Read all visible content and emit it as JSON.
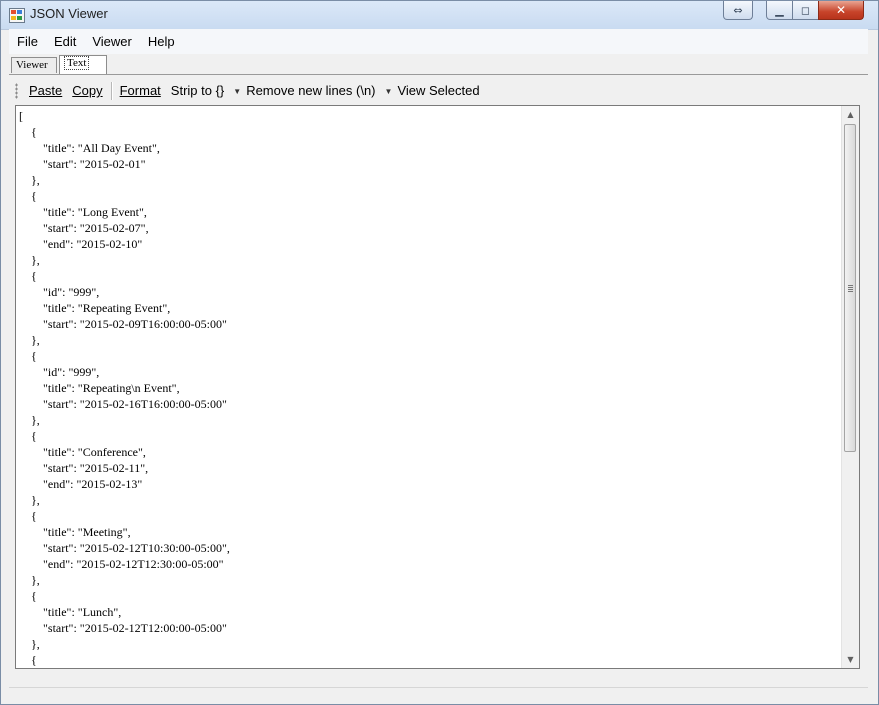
{
  "window": {
    "title": "JSON Viewer"
  },
  "menu": [
    "File",
    "Edit",
    "Viewer",
    "Help"
  ],
  "tabs": {
    "viewer": "Viewer",
    "text": "Text"
  },
  "toolbar": {
    "paste_label": "Paste",
    "copy_label": "Copy",
    "format_label": "Format",
    "strip_label": "Strip to {}",
    "remove_newlines_label": "Remove new lines (\\n)",
    "view_selected_label": "View Selected"
  },
  "editor": {
    "lines": [
      "[",
      "    {",
      "        \"title\": \"All Day Event\",",
      "        \"start\": \"2015-02-01\"",
      "    },",
      "    {",
      "        \"title\": \"Long Event\",",
      "        \"start\": \"2015-02-07\",",
      "        \"end\": \"2015-02-10\"",
      "    },",
      "    {",
      "        \"id\": \"999\",",
      "        \"title\": \"Repeating Event\",",
      "        \"start\": \"2015-02-09T16:00:00-05:00\"",
      "    },",
      "    {",
      "        \"id\": \"999\",",
      "        \"title\": \"Repeating\\n Event\",",
      "        \"start\": \"2015-02-16T16:00:00-05:00\"",
      "    },",
      "    {",
      "        \"title\": \"Conference\",",
      "        \"start\": \"2015-02-11\",",
      "        \"end\": \"2015-02-13\"",
      "    },",
      "    {",
      "        \"title\": \"Meeting\",",
      "        \"start\": \"2015-02-12T10:30:00-05:00\",",
      "        \"end\": \"2015-02-12T12:30:00-05:00\"",
      "    },",
      "    {",
      "        \"title\": \"Lunch\",",
      "        \"start\": \"2015-02-12T12:00:00-05:00\"",
      "    },",
      "    {"
    ]
  },
  "icons": {
    "app": "app-icon",
    "minimize": "minimize-icon",
    "maximize": "maximize-icon",
    "close": "close-icon",
    "scroll_up": "chevron-up-icon",
    "scroll_down": "chevron-down-icon"
  }
}
